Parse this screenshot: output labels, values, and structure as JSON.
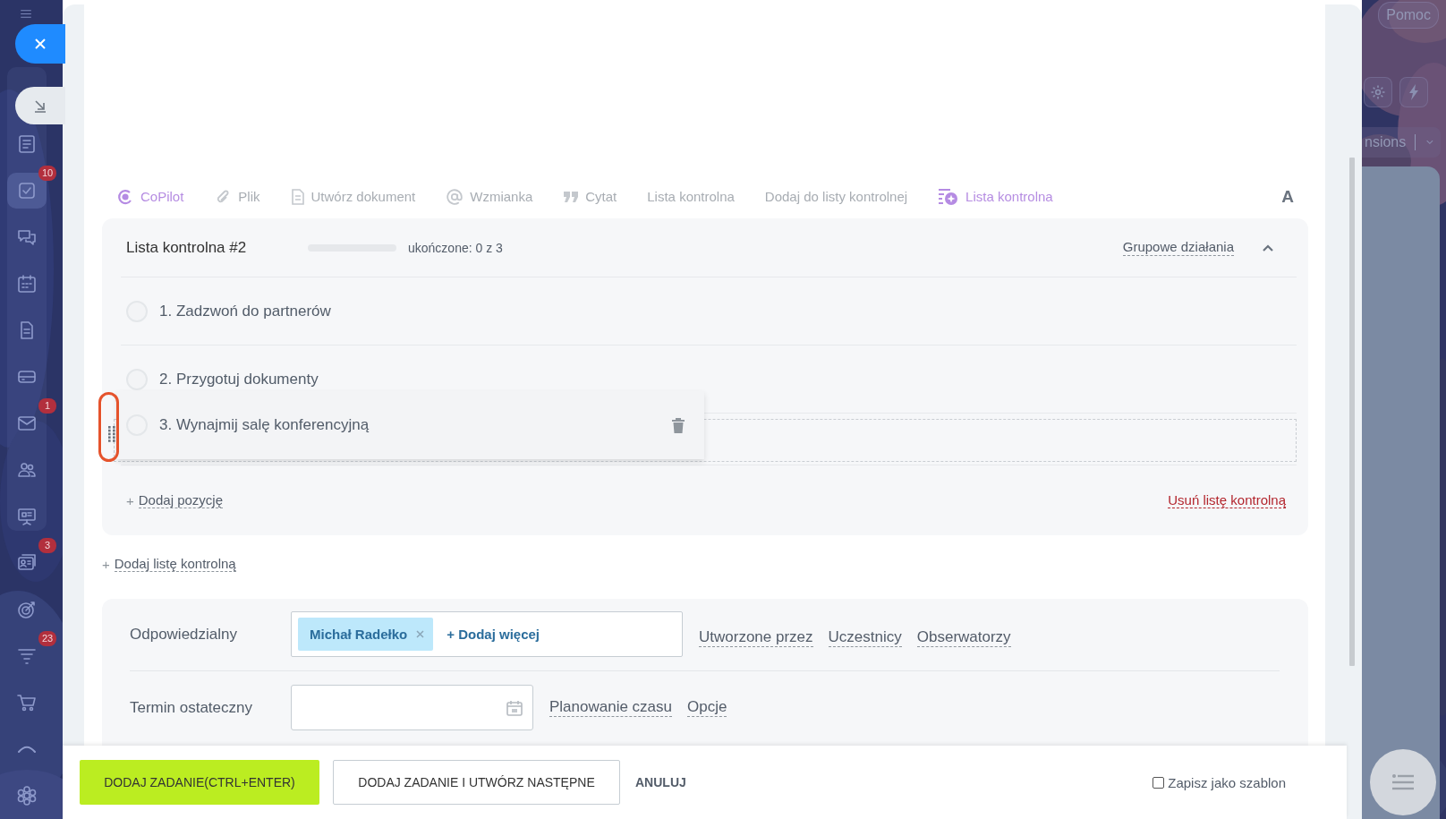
{
  "sidebar": {
    "items": [
      {
        "selected": false
      },
      {
        "selected": true,
        "badge": "10"
      },
      {
        "selected": false
      },
      {
        "selected": false
      },
      {
        "selected": false
      },
      {
        "selected": false
      },
      {
        "selected": false,
        "badge": "1"
      },
      {
        "selected": false
      },
      {
        "selected": false
      },
      {
        "selected": false,
        "badge": "3"
      },
      {
        "selected": false
      },
      {
        "selected": false,
        "badge": "23"
      },
      {
        "selected": false
      },
      {
        "selected": false
      },
      {
        "selected": false
      }
    ]
  },
  "right_area": {
    "help": "Pomoc",
    "extensions": "nsions"
  },
  "toolbar": {
    "items": [
      {
        "label": "CoPilot",
        "kind": "copilot",
        "highlighted": true
      },
      {
        "label": "Plik",
        "kind": "file",
        "highlighted": false
      },
      {
        "label": "Utwórz dokument",
        "kind": "document",
        "highlighted": false
      },
      {
        "label": "Wzmianka",
        "kind": "mention",
        "highlighted": false
      },
      {
        "label": "Cytat",
        "kind": "quote",
        "highlighted": false
      },
      {
        "label": "Lista kontrolna",
        "kind": "text",
        "highlighted": false
      },
      {
        "label": "Dodaj do listy kontrolnej",
        "kind": "text",
        "highlighted": false
      },
      {
        "label": "Lista kontrolna",
        "kind": "checklist-ai",
        "highlighted": true
      }
    ],
    "format": "A"
  },
  "checklist": {
    "title": "Lista kontrolna #2",
    "level": 0,
    "progress": "ukończone: 0 z 3",
    "group_actions": "Grupowe działania",
    "expanded": true,
    "items": [
      {
        "text": "1. Zadzwoń do partnerów",
        "checked": false,
        "dragging": false
      },
      {
        "text": "2. Przygotuj dokumenty",
        "checked": false,
        "dragging": false
      },
      {
        "text": "3. Wynajmij salę konferencyjną",
        "checked": false,
        "dragging": true
      }
    ],
    "add_item_plus": "+",
    "add_item": "Dodaj pozycję",
    "delete": "Usuń listę kontrolną"
  },
  "add_checklist": {
    "plus": "+",
    "label": "Dodaj listę kontrolną"
  },
  "form": {
    "rows": [
      {
        "kind": "people",
        "label": "Odpowiedzialny",
        "chips": [
          "Michał Radełko"
        ],
        "add": "+ Dodaj więcej",
        "links": [
          "Utworzone przez",
          "Uczestnicy",
          "Obserwatorzy"
        ]
      },
      {
        "kind": "date",
        "label": "Termin ostateczny",
        "links": [
          "Planowanie czasu",
          "Opcje"
        ]
      }
    ]
  },
  "footer": {
    "buttons": [
      {
        "label": "DODAJ ZADANIE(CTRL+ENTER)",
        "kind": "primary"
      },
      {
        "label": "DODAJ ZADANIE I UTWÓRZ NASTĘPNE",
        "kind": "secondary"
      },
      {
        "label": "ANULUJ",
        "kind": "link"
      }
    ],
    "template": {
      "label": "Zapisz jako szablon",
      "checked": false
    }
  }
}
